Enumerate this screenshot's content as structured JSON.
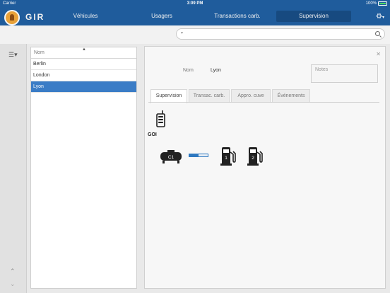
{
  "status_bar": {
    "carrier": "Carrier",
    "time": "3:09 PM",
    "battery": "100%"
  },
  "nav": {
    "brand": "GIR",
    "tabs": [
      {
        "label": "Véhicules"
      },
      {
        "label": "Usagers"
      },
      {
        "label": "Transactions carb."
      },
      {
        "label": "Supervision",
        "active": true
      }
    ]
  },
  "search": {
    "value": "",
    "placeholder": ""
  },
  "list": {
    "header": "Nom",
    "items": [
      {
        "label": "Berlin"
      },
      {
        "label": "London"
      },
      {
        "label": "Lyon",
        "selected": true
      }
    ]
  },
  "detail": {
    "name_label": "Nom",
    "name_value": "Lyon",
    "notes_placeholder": "Notes",
    "tabs": [
      {
        "label": "Supervision",
        "active": true
      },
      {
        "label": "Transac. carb."
      },
      {
        "label": "Appro. cuve"
      },
      {
        "label": "Événements"
      }
    ],
    "device_label": "GOI",
    "tank_label": "C1",
    "tank_level": 0.5,
    "pumps": [
      {
        "label": "1"
      },
      {
        "label": "2"
      }
    ]
  },
  "colors": {
    "nav_bg": "#1f5c9c",
    "selected": "#3a7cc6",
    "gauge": "#2e78c0"
  }
}
